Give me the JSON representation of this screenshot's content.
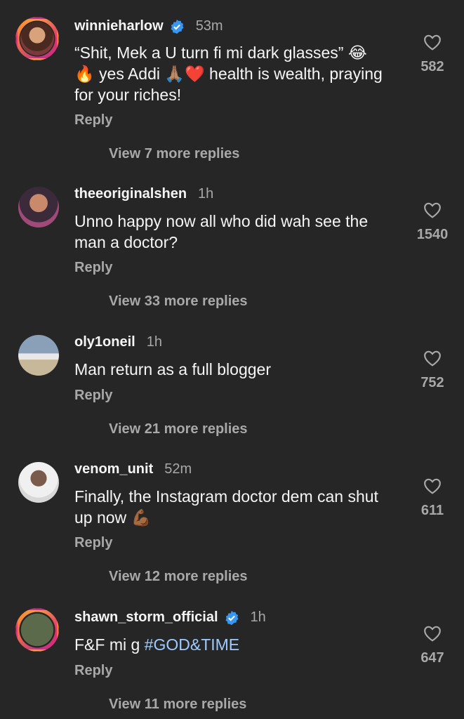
{
  "comments": [
    {
      "username": "winnieharlow",
      "verified": true,
      "time": "53m",
      "text_parts": [
        "“Shit, Mek a U turn fi mi dark glasses” 😂",
        "🔥 yes Addi 🙏🏽❤️ health is wealth,  praying",
        "for your riches!"
      ],
      "reply": "Reply",
      "view_replies": "View 7 more replies",
      "likes": "582"
    },
    {
      "username": "theeoriginalshen",
      "verified": false,
      "time": "1h",
      "text_parts": [
        "Unno happy now all who did wah see the",
        "man a doctor?"
      ],
      "reply": "Reply",
      "view_replies": "View 33 more replies",
      "likes": "1540"
    },
    {
      "username": "oly1oneil",
      "verified": false,
      "time": "1h",
      "text_parts": [
        "Man return as a full blogger"
      ],
      "reply": "Reply",
      "view_replies": "View 21 more replies",
      "likes": "752"
    },
    {
      "username": "venom_unit",
      "verified": false,
      "time": "52m",
      "text_parts": [
        "Finally, the Instagram doctor dem can shut",
        "up now 💪🏾"
      ],
      "reply": "Reply",
      "view_replies": "View 12 more replies",
      "likes": "611"
    },
    {
      "username": "shawn_storm_official",
      "verified": true,
      "time": "1h",
      "text_prefix": "F&F mi g ",
      "hashtag": "#GOD&TIME",
      "reply": "Reply",
      "view_replies": "View 11 more replies",
      "likes": "647"
    }
  ],
  "icons": {
    "like": "heart-outline-icon",
    "verified": "verified-badge-icon"
  },
  "colors": {
    "background": "#262626",
    "muted": "#a8a8a8",
    "verified": "#3897f0",
    "hashtag": "#9ecbff"
  }
}
